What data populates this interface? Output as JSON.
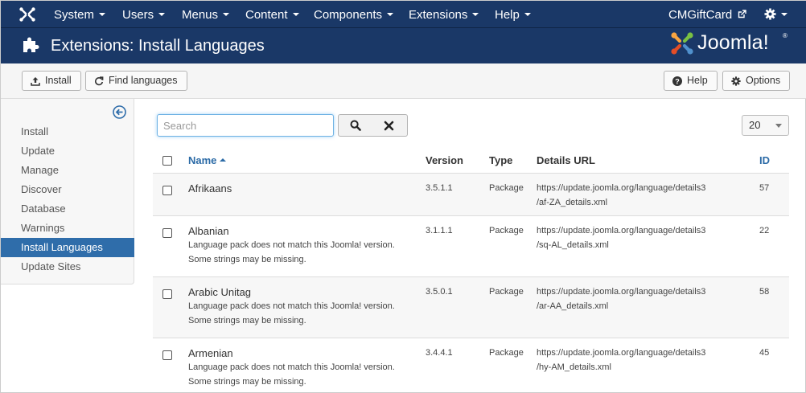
{
  "navbar": {
    "items": [
      "System",
      "Users",
      "Menus",
      "Content",
      "Components",
      "Extensions",
      "Help"
    ],
    "site_link": "CMGiftCard"
  },
  "header": {
    "title": "Extensions: Install Languages",
    "brand": "Joomla!",
    "brand_mark": "®"
  },
  "toolbar": {
    "install_label": "Install",
    "find_label": "Find languages",
    "help_label": "Help",
    "options_label": "Options"
  },
  "sidebar": {
    "items": [
      "Install",
      "Update",
      "Manage",
      "Discover",
      "Database",
      "Warnings",
      "Install Languages",
      "Update Sites"
    ],
    "active_index": 6
  },
  "search": {
    "placeholder": "Search",
    "value": ""
  },
  "list_limit": "20",
  "table": {
    "columns": {
      "name": "Name",
      "version": "Version",
      "type": "Type",
      "url": "Details URL",
      "id": "ID"
    },
    "rows": [
      {
        "name": "Afrikaans",
        "warning1": "",
        "warning2": "",
        "version": "3.5.1.1",
        "type": "Package",
        "url1": "https://update.joomla.org/language/details3",
        "url2": "/af-ZA_details.xml",
        "id": "57"
      },
      {
        "name": "Albanian",
        "warning1": "Language pack does not match this Joomla! version.",
        "warning2": "Some strings may be missing.",
        "version": "3.1.1.1",
        "type": "Package",
        "url1": "https://update.joomla.org/language/details3",
        "url2": "/sq-AL_details.xml",
        "id": "22"
      },
      {
        "name": "Arabic Unitag",
        "warning1": "Language pack does not match this Joomla! version.",
        "warning2": "Some strings may be missing.",
        "version": "3.5.0.1",
        "type": "Package",
        "url1": "https://update.joomla.org/language/details3",
        "url2": "/ar-AA_details.xml",
        "id": "58"
      },
      {
        "name": "Armenian",
        "warning1": "Language pack does not match this Joomla! version.",
        "warning2": "Some strings may be missing.",
        "version": "3.4.4.1",
        "type": "Package",
        "url1": "https://update.joomla.org/language/details3",
        "url2": "/hy-AM_details.xml",
        "id": "45"
      }
    ]
  },
  "colors": {
    "navbar": "#1a3867",
    "active": "#2f6daa",
    "link": "#2b6aa6",
    "brand_red": "#e44d26",
    "brand_orange": "#f9a541",
    "brand_green": "#7ac143",
    "brand_blue": "#5091cd"
  }
}
